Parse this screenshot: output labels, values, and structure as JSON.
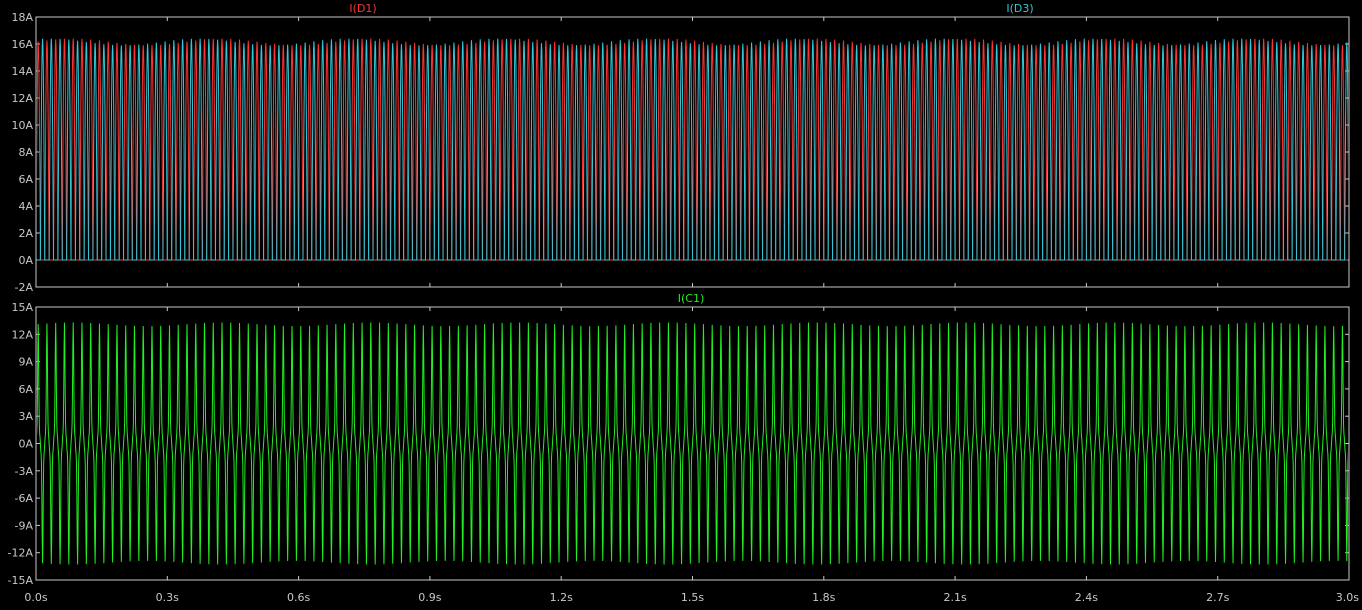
{
  "chart_data": [
    {
      "type": "line",
      "legend": "top",
      "grid": false,
      "xlim": [
        0.0,
        3.0
      ],
      "ylim": [
        -2,
        18
      ],
      "x_ticks": [
        "0.0s",
        "0.3s",
        "0.6s",
        "0.9s",
        "1.2s",
        "1.5s",
        "1.8s",
        "2.1s",
        "2.4s",
        "2.7s",
        "3.0s"
      ],
      "y_ticks": [
        {
          "value": -2,
          "label": "-2A"
        },
        {
          "value": 0,
          "label": "0A"
        },
        {
          "value": 2,
          "label": "2A"
        },
        {
          "value": 4,
          "label": "4A"
        },
        {
          "value": 6,
          "label": "6A"
        },
        {
          "value": 8,
          "label": "8A"
        },
        {
          "value": 10,
          "label": "10A"
        },
        {
          "value": 12,
          "label": "12A"
        },
        {
          "value": 14,
          "label": "14A"
        },
        {
          "value": 16,
          "label": "16A"
        },
        {
          "value": 18,
          "label": "18A"
        }
      ],
      "series": [
        {
          "name": "I(D1)",
          "color": "#ff3333",
          "waveform": "half-wave-rectified",
          "cycles": 150,
          "peak": 16.4,
          "min": 0,
          "phase": 0
        },
        {
          "name": "I(D3)",
          "color": "#30c8d8",
          "waveform": "half-wave-rectified",
          "cycles": 150,
          "peak": 16.4,
          "min": 0,
          "phase": 0.5
        }
      ]
    },
    {
      "type": "line",
      "legend": "top",
      "grid": false,
      "xlim": [
        0.0,
        3.0
      ],
      "ylim": [
        -15,
        15
      ],
      "x_ticks": [
        "0.0s",
        "0.3s",
        "0.6s",
        "0.9s",
        "1.2s",
        "1.5s",
        "1.8s",
        "2.1s",
        "2.4s",
        "2.7s",
        "3.0s"
      ],
      "y_ticks": [
        {
          "value": -15,
          "label": "-15A"
        },
        {
          "value": -12,
          "label": "-12A"
        },
        {
          "value": -9,
          "label": "-9A"
        },
        {
          "value": -6,
          "label": "-6A"
        },
        {
          "value": -3,
          "label": "-3A"
        },
        {
          "value": 0,
          "label": "0A"
        },
        {
          "value": 3,
          "label": "3A"
        },
        {
          "value": 6,
          "label": "6A"
        },
        {
          "value": 9,
          "label": "9A"
        },
        {
          "value": 12,
          "label": "12A"
        },
        {
          "value": 15,
          "label": "15A"
        }
      ],
      "series": [
        {
          "name": "I(C1)",
          "color": "#22ee22",
          "waveform": "capacitor-ripple",
          "cycles": 150,
          "peak": 13.3,
          "min": -13.3
        }
      ]
    }
  ],
  "colors": {
    "background": "#000000",
    "frame": "#c8c8c8",
    "axis_text": "#c8c8c8"
  }
}
